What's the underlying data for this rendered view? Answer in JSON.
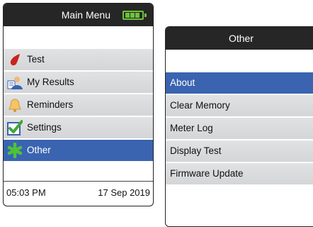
{
  "main_menu": {
    "title": "Main Menu",
    "battery_icon": "battery-full-icon",
    "items": [
      {
        "label": "Test",
        "icon": "blood-drop-icon",
        "selected": false
      },
      {
        "label": "My Results",
        "icon": "person-results-icon",
        "selected": false
      },
      {
        "label": "Reminders",
        "icon": "bell-icon",
        "selected": false
      },
      {
        "label": "Settings",
        "icon": "checkmark-icon",
        "selected": false
      },
      {
        "label": "Other",
        "icon": "asterisk-icon",
        "selected": true
      }
    ],
    "time": "05:03 PM",
    "date": "17 Sep 2019"
  },
  "other_menu": {
    "title": "Other",
    "items": [
      {
        "label": "About",
        "selected": true
      },
      {
        "label": "Clear Memory",
        "selected": false
      },
      {
        "label": "Meter Log",
        "selected": false
      },
      {
        "label": "Display Test",
        "selected": false
      },
      {
        "label": "Firmware Update",
        "selected": false
      }
    ]
  },
  "colors": {
    "titlebar_bg": "#262626",
    "selected_bg": "#3a64b0",
    "item_bg": "#d8d9db",
    "battery": "#6dc23a"
  }
}
